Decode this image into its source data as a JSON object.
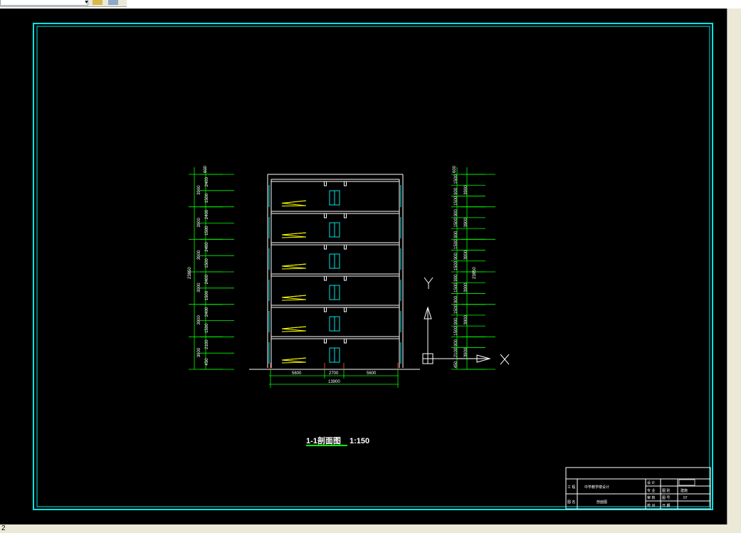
{
  "window": {
    "layout_tab": "2"
  },
  "drawing": {
    "colors": {
      "border": "#00e5e5",
      "dim": "#00ff00",
      "stairs": "#ffff00",
      "window": "#00e5e5",
      "wall": "#ffffff"
    },
    "section_title": "1-1剖面图",
    "section_scale": "1:150",
    "ucs": {
      "x": "X",
      "y": "Y"
    },
    "bottom_dims": {
      "d1": "5600",
      "d2": "2700",
      "d3": "5600",
      "total": "13900"
    },
    "left_dims": {
      "top": "600",
      "chain": [
        "2400",
        "1500",
        "2400",
        "1500",
        "2400",
        "1500",
        "2400",
        "1500",
        "2400",
        "1500",
        "2100",
        "450"
      ],
      "floors": [
        "3900",
        "3900",
        "3900",
        "3900",
        "3900",
        "3900"
      ],
      "total": "23850"
    },
    "right_dims": {
      "top": "600",
      "chain": [
        "1500",
        "900",
        "1500",
        "900",
        "1500",
        "900",
        "1500",
        "900",
        "1500",
        "900",
        "1500",
        "900",
        "1500",
        "900",
        "1500",
        "900",
        "2100",
        "450"
      ],
      "floors": [
        "3900",
        "3900",
        "3900",
        "3900",
        "3900",
        "3900"
      ],
      "total": "23850"
    },
    "title_block": {
      "project_label": "工 程",
      "project_name": "中学教学楼设计",
      "drawing_label": "图 名",
      "drawing_name": "剖面图",
      "col2": [
        "设 计",
        "专 业",
        "审 核",
        "校 对"
      ],
      "col3": [
        "",
        "图 别",
        "图 号",
        "日 期"
      ],
      "col4": [
        "",
        "建施",
        "07",
        ""
      ]
    }
  }
}
